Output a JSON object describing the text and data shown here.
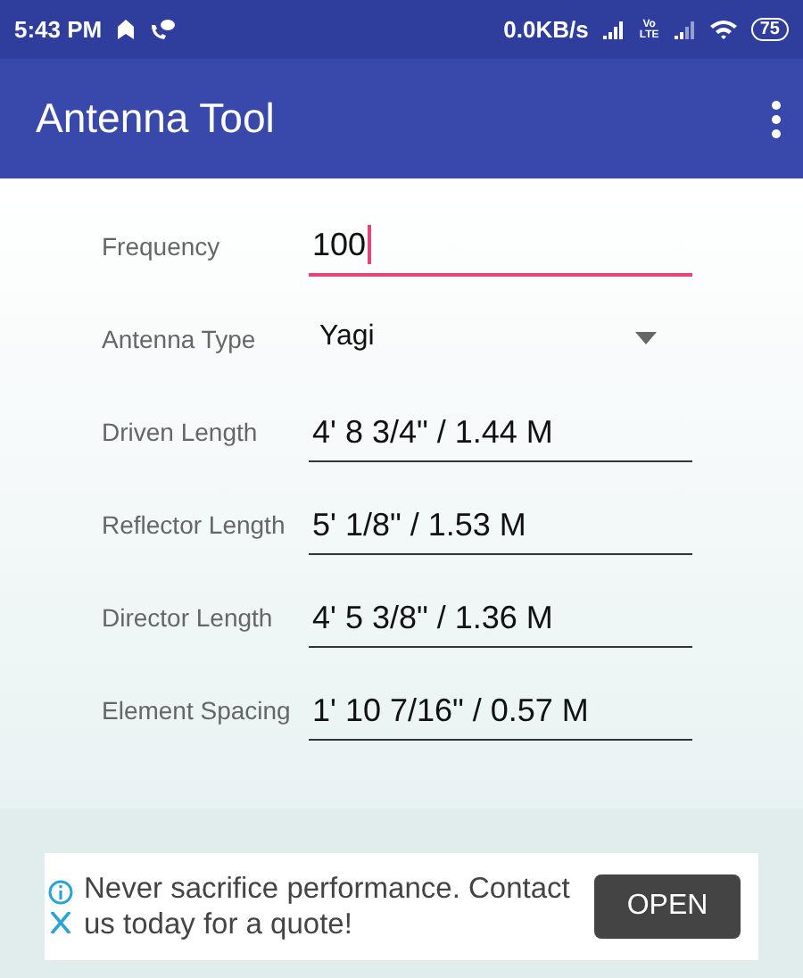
{
  "status_bar": {
    "time": "5:43 PM",
    "net_speed": "0.0KB/s",
    "volte": "Vo LTE",
    "battery": "75"
  },
  "app_bar": {
    "title": "Antenna Tool"
  },
  "fields": [
    {
      "kind": "input",
      "label": "Frequency",
      "value": "100",
      "focused": true
    },
    {
      "kind": "dropdown",
      "label": "Antenna Type",
      "value": "Yagi"
    },
    {
      "kind": "output",
      "label": "Driven Length",
      "value": "4' 8 3/4\" / 1.44 M"
    },
    {
      "kind": "output",
      "label": "Reflector Length",
      "value": "5' 1/8\" / 1.53 M"
    },
    {
      "kind": "output",
      "label": "Director Length",
      "value": "4' 5 3/8\" / 1.36 M"
    },
    {
      "kind": "output",
      "label": "Element Spacing",
      "value": "1' 10 7/16\" / 0.57 M"
    }
  ],
  "ad": {
    "text": "Never sacrifice performance. Contact us today for a quote!",
    "button": "OPEN"
  }
}
